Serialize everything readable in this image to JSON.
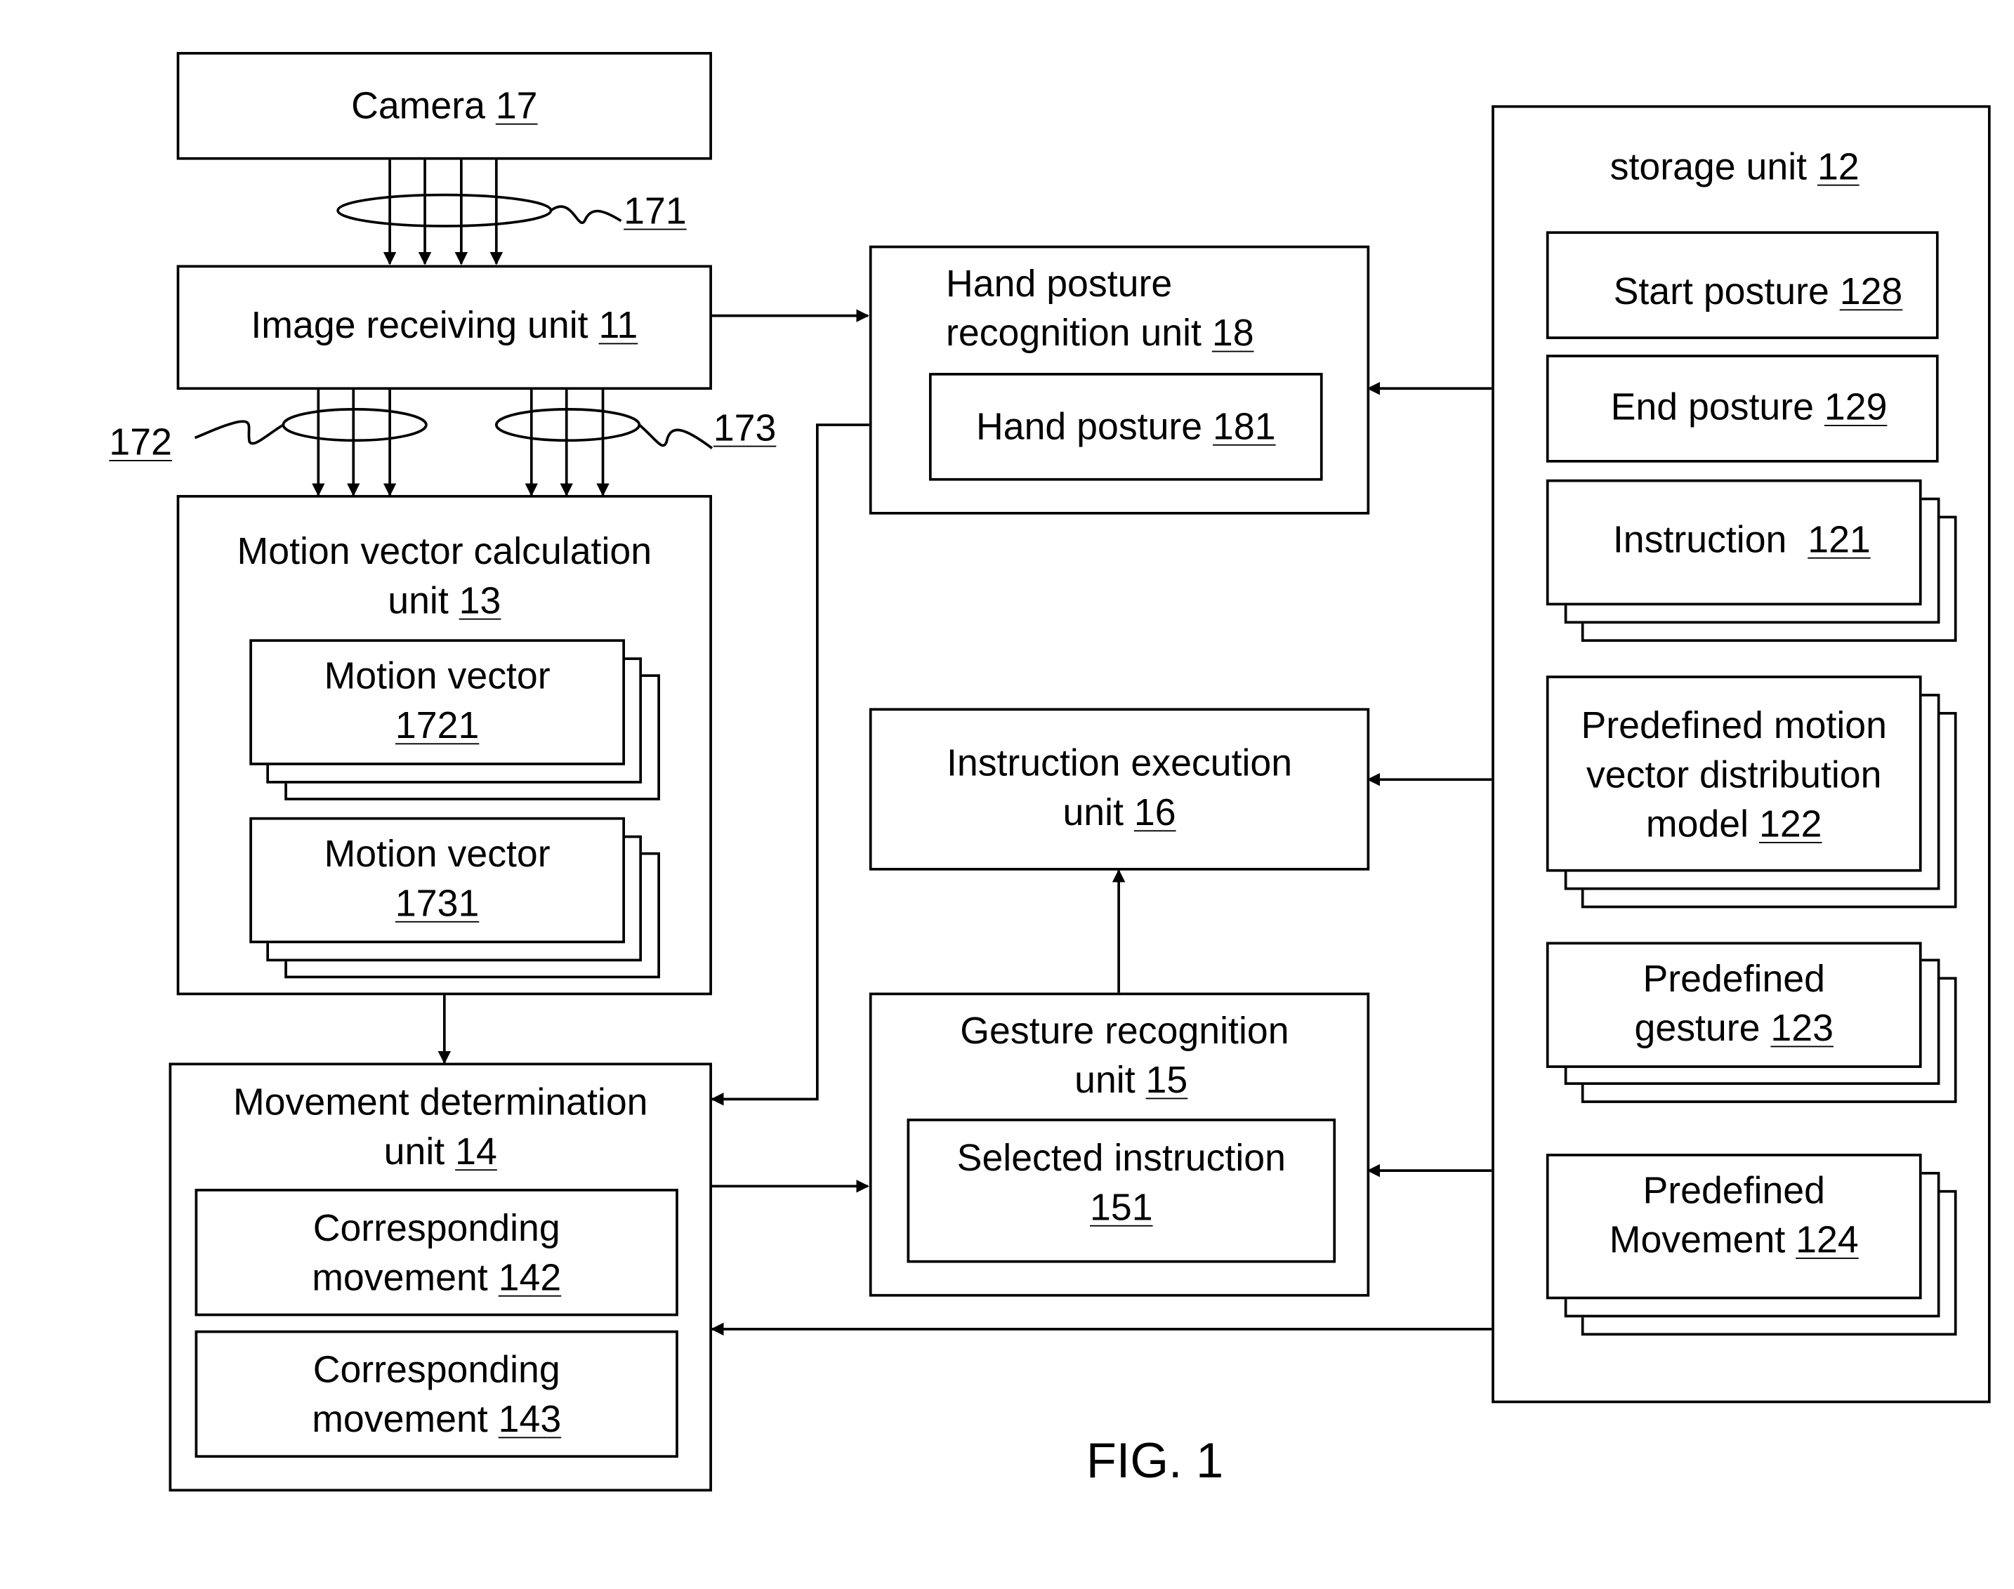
{
  "figure_label": "FIG. 1",
  "blocks": {
    "camera": {
      "text": "Camera ",
      "num": "17"
    },
    "image_receiving": {
      "text": "Image receiving unit ",
      "num": "11"
    },
    "motion_vector_calc": {
      "line1": "Motion vector calculation",
      "line2": "unit ",
      "num": "13"
    },
    "motion_vector_1721": {
      "line1": "Motion vector",
      "num": "1721"
    },
    "motion_vector_1731": {
      "line1": "Motion vector",
      "num": "1731"
    },
    "movement_determination": {
      "line1": "Movement determination",
      "line2": "unit ",
      "num": "14"
    },
    "corresponding_142": {
      "line1": "Corresponding",
      "line2": "movement ",
      "num": "142"
    },
    "corresponding_143": {
      "line1": "Corresponding",
      "line2": "movement ",
      "num": "143"
    },
    "hand_posture_recognition": {
      "line1": "Hand posture",
      "line2": "recognition unit ",
      "num": "18"
    },
    "hand_posture": {
      "text": "Hand posture ",
      "num": "181"
    },
    "instruction_execution": {
      "line1": "Instruction execution",
      "line2": "unit ",
      "num": "16"
    },
    "gesture_recognition": {
      "line1": "Gesture recognition",
      "line2": "unit ",
      "num": "15"
    },
    "selected_instruction": {
      "line1": "Selected instruction",
      "num": "151"
    },
    "storage": {
      "text": "storage unit ",
      "num": "12"
    },
    "start_posture": {
      "text": "Start posture ",
      "num": "128"
    },
    "end_posture": {
      "text": "End posture ",
      "num": "129"
    },
    "instruction": {
      "text": "Instruction  ",
      "num": "121"
    },
    "predefined_model": {
      "line1": "Predefined motion",
      "line2": "vector distribution",
      "line3": "model ",
      "num": "122"
    },
    "predefined_gesture": {
      "line1": "Predefined",
      "line2": "gesture ",
      "num": "123"
    },
    "predefined_movement": {
      "line1": "Predefined",
      "line2": "Movement ",
      "num": "124"
    }
  },
  "signal_labels": {
    "s171": "171",
    "s172": "172",
    "s173": "173"
  }
}
